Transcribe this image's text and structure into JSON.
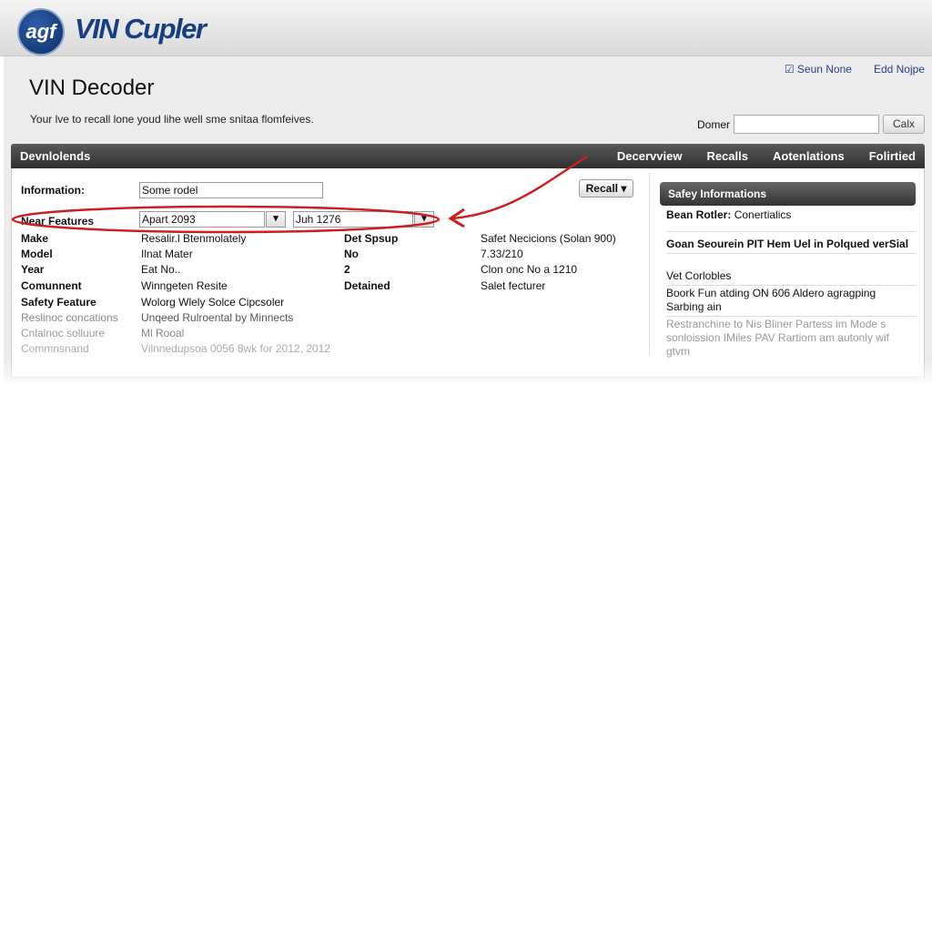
{
  "app": {
    "logo_mark": "agf",
    "logo_text": "VIN Cupler"
  },
  "top_links": [
    "Seun None",
    "Edd Nojpe"
  ],
  "page": {
    "title": "VIN Decoder",
    "subtitle": "Your lve to recall lone youd lihe well sme snitaa flomfeives."
  },
  "search": {
    "label": "Domer",
    "value": "",
    "button": "Calx"
  },
  "navbar": {
    "section": "Devnlolends",
    "tabs": [
      "Decervview",
      "Recalls",
      "Aotenlations",
      "Folirtied"
    ]
  },
  "form": {
    "information_label": "Information:",
    "information_value": "Some rodel",
    "near_features_label": "Near Features",
    "date_from": "Apart 2093",
    "date_to": "Juh 1276",
    "recall_button": "Recall ▾"
  },
  "rows": [
    {
      "label": "Make",
      "value": "Resalir.l Btenmolately",
      "mid_label": "Det Spsup",
      "mid_value": "Safet Necicions (Solan 900)"
    },
    {
      "label": "Model",
      "value": "Ilnat Mater",
      "mid_label": "No",
      "mid_value": "7.33/210"
    },
    {
      "label": "Year",
      "value": "Eat No..",
      "mid_label": "2",
      "mid_value": "Clon onc No a 1210"
    },
    {
      "label": "Comunnent",
      "value": "Winngeten Resite",
      "mid_label": "Detained",
      "mid_value": "Salet fecturer"
    },
    {
      "label": "Safety Feature",
      "value": "Wolorg Wlely Solce Cipcsoler"
    },
    {
      "label": "Reslinoc concations",
      "value": "Unqeed Rulroental by Minnects"
    },
    {
      "label": "Cnlalnoc solluure",
      "value": "Ml Rooal"
    },
    {
      "label": "Commnsnand",
      "value": "Vilnnedupsoa 0056 8wk for 2012, 2012"
    }
  ],
  "safety_panel": {
    "title": "Safey Informations",
    "lead_label": "Bean Rotler:",
    "lead_value": "Conertialics",
    "items": [
      "Goan Seourein PIT Hem Uel in Polqued verSial",
      "Vet Corlobles",
      "Boork Fun atding ON 606 Aldero agragping Sarbing ain",
      "Restranchine to Nis Bliner Partess im Mode s sonloission IMiles PAV Rartiom am autonly wif gtvm"
    ]
  },
  "colors": {
    "annotation": "#cc1f1f",
    "link": "#2a3d8f",
    "logo": "#173e82"
  },
  "icons": {
    "calendar": "calendar-icon",
    "top_link": "checkbox-icon"
  }
}
